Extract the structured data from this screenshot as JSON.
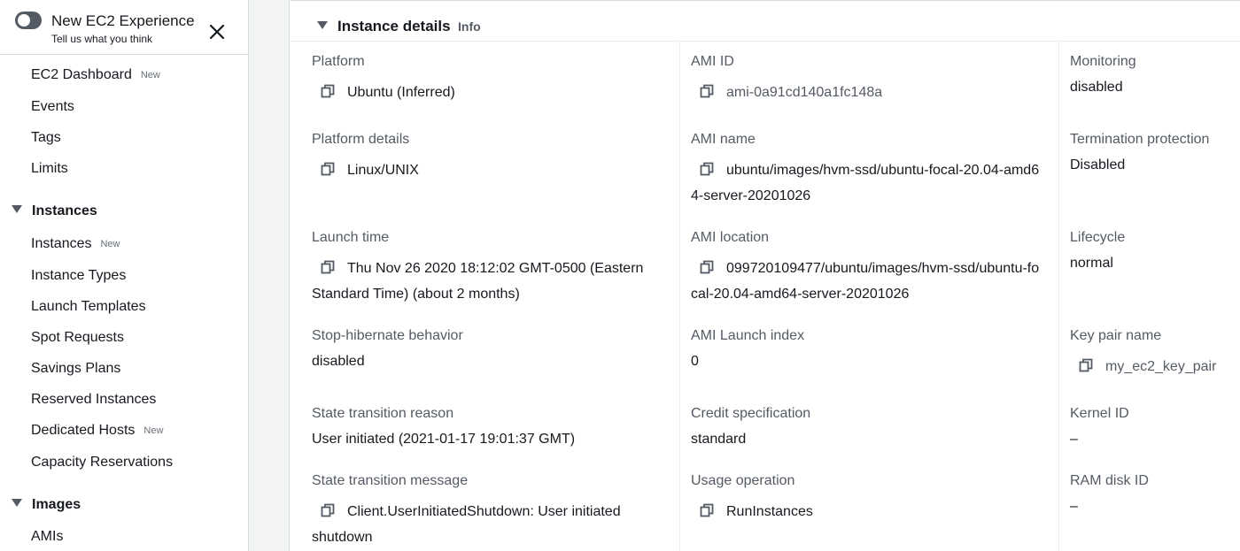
{
  "sidebar": {
    "experience_title": "New EC2 Experience",
    "experience_subtitle": "Tell us what you think",
    "items": [
      {
        "label": "EC2 Dashboard",
        "badge": "New"
      },
      {
        "label": "Events"
      },
      {
        "label": "Tags"
      },
      {
        "label": "Limits"
      }
    ],
    "sections": [
      {
        "label": "Instances",
        "items": [
          {
            "label": "Instances",
            "badge": "New"
          },
          {
            "label": "Instance Types"
          },
          {
            "label": "Launch Templates"
          },
          {
            "label": "Spot Requests"
          },
          {
            "label": "Savings Plans"
          },
          {
            "label": "Reserved Instances"
          },
          {
            "label": "Dedicated Hosts",
            "badge": "New"
          },
          {
            "label": "Capacity Reservations"
          }
        ]
      },
      {
        "label": "Images",
        "items": [
          {
            "label": "AMIs"
          }
        ]
      }
    ]
  },
  "panel": {
    "title": "Instance details",
    "info": "Info"
  },
  "details": {
    "platform": {
      "label": "Platform",
      "value": "Ubuntu (Inferred)"
    },
    "platform_details": {
      "label": "Platform details",
      "value": "Linux/UNIX"
    },
    "launch_time": {
      "label": "Launch time",
      "value": "Thu Nov 26 2020 18:12:02 GMT-0500 (Eastern Standard Time) (about 2 months)"
    },
    "stop_hibernate": {
      "label": "Stop-hibernate behavior",
      "value": "disabled"
    },
    "state_reason": {
      "label": "State transition reason",
      "value": "User initiated (2021-01-17 19:01:37 GMT)"
    },
    "state_message": {
      "label": "State transition message",
      "value": "Client.UserInitiatedShutdown: User initiated shutdown"
    },
    "ami_id": {
      "label": "AMI ID",
      "value": "ami-0a91cd140a1fc148a"
    },
    "ami_name": {
      "label": "AMI name",
      "value": "ubuntu/images/hvm-ssd/ubuntu-focal-20.04-amd64-server-20201026"
    },
    "ami_location": {
      "label": "AMI location",
      "value": "099720109477/ubuntu/images/hvm-ssd/ubuntu-focal-20.04-amd64-server-20201026"
    },
    "ami_launch_index": {
      "label": "AMI Launch index",
      "value": "0"
    },
    "credit_spec": {
      "label": "Credit specification",
      "value": "standard"
    },
    "usage_operation": {
      "label": "Usage operation",
      "value": "RunInstances"
    },
    "monitoring": {
      "label": "Monitoring",
      "value": "disabled"
    },
    "termination_protection": {
      "label": "Termination protection",
      "value": "Disabled"
    },
    "lifecycle": {
      "label": "Lifecycle",
      "value": "normal"
    },
    "key_pair": {
      "label": "Key pair name",
      "value": "my_ec2_key_pair"
    },
    "kernel_id": {
      "label": "Kernel ID",
      "value": "–"
    },
    "ramdisk_id": {
      "label": "RAM disk ID",
      "value": "–"
    }
  },
  "colors": {
    "text": "#16191f",
    "secondary": "#545b64",
    "border": "#d5dbdb",
    "gutter": "#f2f3f3"
  }
}
